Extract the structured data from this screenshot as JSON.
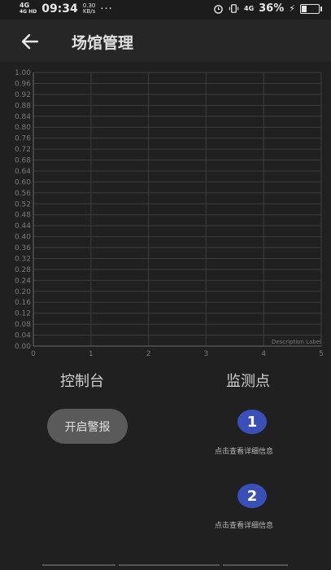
{
  "status_bar": {
    "network": "4G",
    "signal_label": "4G HD",
    "time": "09:34",
    "speed_value": "0.30",
    "speed_unit": "KB/s",
    "more": "···",
    "network2": "4G",
    "battery": "36%",
    "battery_level": 0.36
  },
  "app_bar": {
    "title": "场馆管理"
  },
  "chart_data": {
    "type": "line",
    "series": [],
    "xlim": [
      0,
      5
    ],
    "ylim": [
      0,
      1
    ],
    "x_ticks": [
      "0",
      "1",
      "2",
      "3",
      "4",
      "5"
    ],
    "y_ticks": [
      "0.00",
      "0.04",
      "0.08",
      "0.12",
      "0.16",
      "0.20",
      "0.24",
      "0.28",
      "0.32",
      "0.36",
      "0.40",
      "0.44",
      "0.48",
      "0.52",
      "0.56",
      "0.60",
      "0.64",
      "0.68",
      "0.72",
      "0.76",
      "0.80",
      "0.84",
      "0.88",
      "0.92",
      "0.96",
      "1.00"
    ],
    "description": "Description Label",
    "grid": true
  },
  "control_panel": {
    "title": "控制台",
    "alarm_button": "开启警报"
  },
  "monitor_panel": {
    "title": "监测点",
    "points": [
      {
        "number": "1",
        "label": "点击查看详细信息"
      },
      {
        "number": "2",
        "label": "点击查看详细信息"
      }
    ]
  },
  "colors": {
    "background": "#202020",
    "app_bar": "#262626",
    "marker": "#3a50b8",
    "button": "#5a5a5a"
  }
}
